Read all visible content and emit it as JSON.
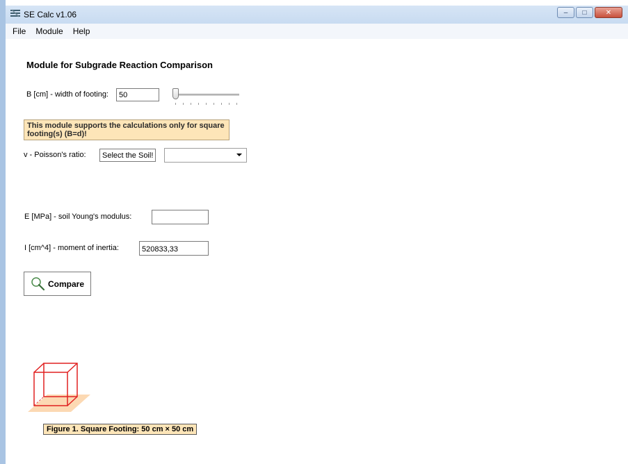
{
  "window": {
    "title": "SE Calc v1.06",
    "buttons": {
      "minimize": "–",
      "maximize": "□",
      "close": "✕"
    }
  },
  "menu": [
    "File",
    "Module",
    "Help"
  ],
  "module": {
    "heading": "Module for Subgrade Reaction Comparison",
    "width_label": "B [cm] - width of footing:",
    "width_value": "50",
    "slider_value_fraction": 0.0,
    "warning": "This module  supports the calculations only for square footing(s) (B=d)!",
    "poisson_label": "v - Poisson's ratio:",
    "select_soil_label": "Select the Soil!",
    "soil_dropdown_value": "",
    "young_label": "E [MPa] - soil Young's modulus:",
    "young_value": "",
    "inertia_label": "I [cm^4] - moment of inertia:",
    "inertia_value": "520833,33",
    "compare_label": "Compare",
    "caption": "Figure 1. Square Footing: 50 cm × 50 cm"
  },
  "colors": {
    "warning_bg": "#fde5b8",
    "figure_line": "#e02020",
    "figure_base": "#fcd9b3"
  }
}
